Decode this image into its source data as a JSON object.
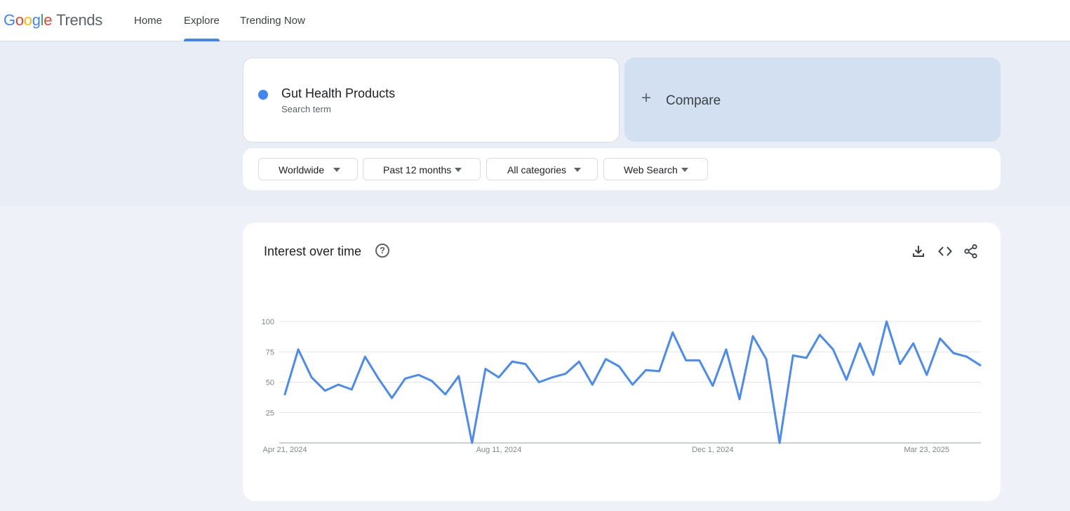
{
  "header": {
    "logo_google": [
      "G",
      "o",
      "o",
      "g",
      "l",
      "e"
    ],
    "logo_trends": "Trends",
    "nav": [
      {
        "label": "Home",
        "active": false
      },
      {
        "label": "Explore",
        "active": true
      },
      {
        "label": "Trending Now",
        "active": false
      }
    ]
  },
  "search": {
    "term": "Gut Health Products",
    "term_type": "Search term",
    "term_color": "#4285f4",
    "compare_label": "Compare",
    "compare_icon": "plus-icon"
  },
  "filters": [
    {
      "label": "Worldwide",
      "icon": "dropdown-arrow-icon"
    },
    {
      "label": "Past 12 months",
      "icon": "dropdown-arrow-icon"
    },
    {
      "label": "All categories",
      "icon": "dropdown-arrow-icon"
    },
    {
      "label": "Web Search",
      "icon": "dropdown-arrow-icon"
    }
  ],
  "chart_card": {
    "title": "Interest over time",
    "help_icon": "help-circle-icon",
    "actions": [
      "download-icon",
      "embed-code-icon",
      "share-icon"
    ]
  },
  "chart_data": {
    "type": "line",
    "title": "Interest over time",
    "xlabel": "",
    "ylabel": "",
    "ylim": [
      0,
      100
    ],
    "yticks": [
      25,
      50,
      75,
      100
    ],
    "xtick_labels": [
      "Apr 21, 2024",
      "Aug 11, 2024",
      "Dec 1, 2024",
      "Mar 23, 2025"
    ],
    "xtick_indices": [
      0,
      16,
      32,
      48
    ],
    "grid": true,
    "line_color": "#4a8af4",
    "series": [
      {
        "name": "Gut Health Products",
        "values": [
          40,
          77,
          54,
          43,
          48,
          44,
          71,
          53,
          37,
          53,
          56,
          51,
          40,
          55,
          0,
          61,
          54,
          67,
          65,
          50,
          54,
          57,
          67,
          48,
          69,
          63,
          48,
          60,
          59,
          91,
          68,
          68,
          47,
          77,
          36,
          88,
          69,
          0,
          72,
          70,
          89,
          77,
          52,
          82,
          56,
          100,
          65,
          82,
          56,
          86,
          74,
          71,
          64
        ]
      }
    ]
  }
}
